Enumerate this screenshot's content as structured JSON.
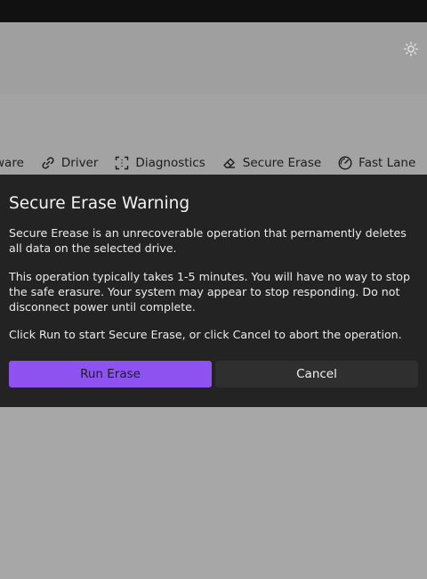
{
  "nav": {
    "items": [
      {
        "label": "ware",
        "icon": "partial-firmware-icon"
      },
      {
        "label": "Driver",
        "icon": "link-icon"
      },
      {
        "label": "Diagnostics",
        "icon": "scan-icon"
      },
      {
        "label": "Secure Erase",
        "icon": "eraser-icon"
      },
      {
        "label": "Fast Lane",
        "icon": "gauge-icon"
      }
    ],
    "more_icon": "menu-icon"
  },
  "header": {
    "theme_icon": "sun-icon"
  },
  "dialog": {
    "title": "Secure Erase Warning",
    "paragraph_1": "Secure Erease is an unrecoverable operation that pernamently deletes all data on the selected drive.",
    "paragraph_2": "This operation typically takes 1-5 minutes. You will have no way to stop the safe erasure. Your system may appear to stop responding. Do not disconnect power until complete.",
    "paragraph_3": "Click Run to start Secure Erase, or click Cancel to abort the operation.",
    "run_label": "Run Erase",
    "cancel_label": "Cancel"
  },
  "colors": {
    "accent": "#8e52f0",
    "dialog_bg": "#232323",
    "overlay_bg": "#a6a6a6"
  }
}
